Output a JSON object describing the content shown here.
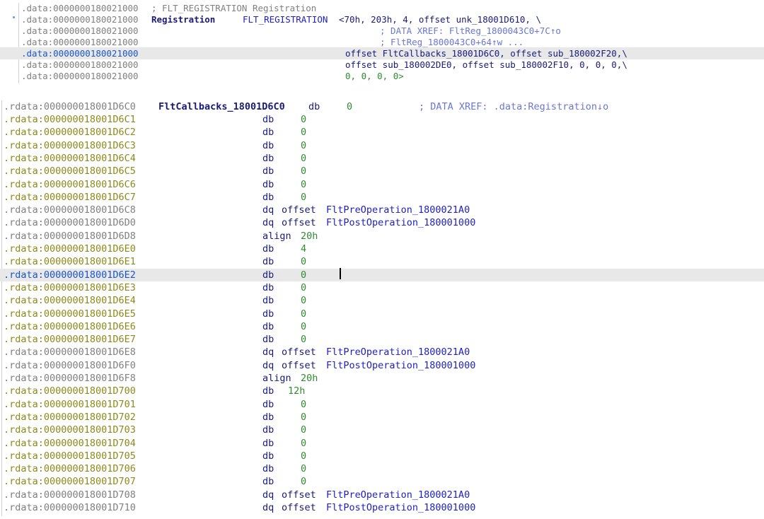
{
  "data_section": {
    "lines": [
      {
        "addr": ".data:0000000180021000",
        "label": "",
        "text": "; FLT_REGISTRATION Registration",
        "kind": "comment_top"
      },
      {
        "addr": ".data:0000000180021000",
        "label": "Registration",
        "mnem": "FLT_REGISTRATION",
        "ops": "<70h, 203h, 4, offset unk_18001D610, \\"
      },
      {
        "addr": ".data:0000000180021000",
        "comment": "; DATA XREF: FltReg_1800043C0+7C↑o"
      },
      {
        "addr": ".data:0000000180021000",
        "comment": "; FltReg_1800043C0+64↑w ..."
      },
      {
        "addr": ".data:0000000180021000",
        "ops": "offset FltCallbacks_18001D6C0, offset sub_180002F20,\\",
        "selected": true
      },
      {
        "addr": ".data:0000000180021000",
        "ops": "offset sub_180002DE0, offset sub_180002F10, 0, 0, 0,\\"
      },
      {
        "addr": ".data:0000000180021000",
        "ops": "0, 0, 0, 0>"
      }
    ]
  },
  "rdata_section": {
    "header": {
      "addr": ".rdata:000000018001D6C0",
      "label": "FltCallbacks_18001D6C0",
      "mnem": "db",
      "val": "0",
      "comment": "; DATA XREF: .data:Registration↓o"
    },
    "lines": [
      {
        "addr": ".rdata:000000018001D6C1",
        "mnem": "db",
        "val": "0",
        "tone": "olive"
      },
      {
        "addr": ".rdata:000000018001D6C2",
        "mnem": "db",
        "val": "0",
        "tone": "olive"
      },
      {
        "addr": ".rdata:000000018001D6C3",
        "mnem": "db",
        "val": "0",
        "tone": "olive"
      },
      {
        "addr": ".rdata:000000018001D6C4",
        "mnem": "db",
        "val": "0",
        "tone": "olive"
      },
      {
        "addr": ".rdata:000000018001D6C5",
        "mnem": "db",
        "val": "0",
        "tone": "olive"
      },
      {
        "addr": ".rdata:000000018001D6C6",
        "mnem": "db",
        "val": "0",
        "tone": "olive"
      },
      {
        "addr": ".rdata:000000018001D6C7",
        "mnem": "db",
        "val": "0",
        "tone": "olive"
      },
      {
        "addr": ".rdata:000000018001D6C8",
        "mnem": "dq",
        "op": "offset",
        "target": "FltPreOperation_1800021A0",
        "tone": "gray"
      },
      {
        "addr": ".rdata:000000018001D6D0",
        "mnem": "dq",
        "op": "offset",
        "target": "FltPostOperation_180001000",
        "tone": "gray"
      },
      {
        "addr": ".rdata:000000018001D6D8",
        "mnem": "align",
        "val": "20h",
        "tone": "gray"
      },
      {
        "addr": ".rdata:000000018001D6E0",
        "mnem": "db",
        "val": "4",
        "tone": "olive"
      },
      {
        "addr": ".rdata:000000018001D6E1",
        "mnem": "db",
        "val": "0",
        "tone": "olive"
      },
      {
        "addr": ".rdata:000000018001D6E2",
        "mnem": "db",
        "val": "0",
        "tone": "sel",
        "selected": true
      },
      {
        "addr": ".rdata:000000018001D6E3",
        "mnem": "db",
        "val": "0",
        "tone": "olive"
      },
      {
        "addr": ".rdata:000000018001D6E4",
        "mnem": "db",
        "val": "0",
        "tone": "olive"
      },
      {
        "addr": ".rdata:000000018001D6E5",
        "mnem": "db",
        "val": "0",
        "tone": "olive"
      },
      {
        "addr": ".rdata:000000018001D6E6",
        "mnem": "db",
        "val": "0",
        "tone": "olive"
      },
      {
        "addr": ".rdata:000000018001D6E7",
        "mnem": "db",
        "val": "0",
        "tone": "olive"
      },
      {
        "addr": ".rdata:000000018001D6E8",
        "mnem": "dq",
        "op": "offset",
        "target": "FltPreOperation_1800021A0",
        "tone": "gray"
      },
      {
        "addr": ".rdata:000000018001D6F0",
        "mnem": "dq",
        "op": "offset",
        "target": "FltPostOperation_180001000",
        "tone": "gray"
      },
      {
        "addr": ".rdata:000000018001D6F8",
        "mnem": "align",
        "val": "20h",
        "tone": "gray"
      },
      {
        "addr": ".rdata:000000018001D700",
        "mnem": "db",
        "val": "12h",
        "tone": "olive"
      },
      {
        "addr": ".rdata:000000018001D701",
        "mnem": "db",
        "val": "0",
        "tone": "olive"
      },
      {
        "addr": ".rdata:000000018001D702",
        "mnem": "db",
        "val": "0",
        "tone": "olive"
      },
      {
        "addr": ".rdata:000000018001D703",
        "mnem": "db",
        "val": "0",
        "tone": "olive"
      },
      {
        "addr": ".rdata:000000018001D704",
        "mnem": "db",
        "val": "0",
        "tone": "olive"
      },
      {
        "addr": ".rdata:000000018001D705",
        "mnem": "db",
        "val": "0",
        "tone": "olive"
      },
      {
        "addr": ".rdata:000000018001D706",
        "mnem": "db",
        "val": "0",
        "tone": "olive"
      },
      {
        "addr": ".rdata:000000018001D707",
        "mnem": "db",
        "val": "0",
        "tone": "olive"
      },
      {
        "addr": ".rdata:000000018001D708",
        "mnem": "dq",
        "op": "offset",
        "target": "FltPreOperation_1800021A0",
        "tone": "gray"
      },
      {
        "addr": ".rdata:000000018001D710",
        "mnem": "dq",
        "op": "offset",
        "target": "FltPostOperation_180001000",
        "tone": "gray"
      }
    ]
  },
  "colors": {
    "selected_line": "#e8e8e8",
    "address_gray": "#808080",
    "address_olive": "#8b8a1c",
    "address_selected": "#1a56c8",
    "label_navy": "#1a1a7a",
    "operand_blue": "#2020c8",
    "number_green": "#2e8b2e",
    "comment": "#6b76d6"
  }
}
